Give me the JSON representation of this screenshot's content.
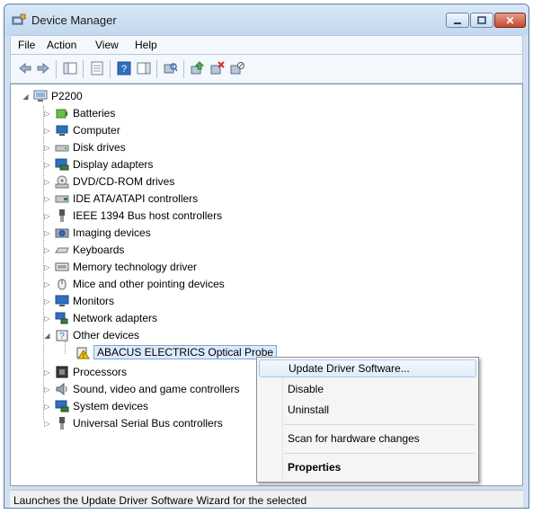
{
  "window": {
    "title": "Device Manager"
  },
  "menu": [
    "File",
    "Action",
    "View",
    "Help"
  ],
  "toolbar_icons": [
    "back-arrow-icon",
    "forward-arrow-icon",
    "show-hide-tree-icon",
    "properties-icon",
    "help-icon",
    "action-pane-icon",
    "scan-hardware-icon",
    "update-driver-icon",
    "uninstall-device-icon",
    "disable-device-icon"
  ],
  "tree": {
    "root": "P2200",
    "categories": [
      {
        "label": "Batteries",
        "icon": "battery-icon",
        "expanded": false
      },
      {
        "label": "Computer",
        "icon": "computer-icon",
        "expanded": false
      },
      {
        "label": "Disk drives",
        "icon": "disk-drive-icon",
        "expanded": false
      },
      {
        "label": "Display adapters",
        "icon": "display-adapter-icon",
        "expanded": false
      },
      {
        "label": "DVD/CD-ROM drives",
        "icon": "dvd-drive-icon",
        "expanded": false
      },
      {
        "label": "IDE ATA/ATAPI controllers",
        "icon": "ide-controller-icon",
        "expanded": false
      },
      {
        "label": "IEEE 1394 Bus host controllers",
        "icon": "firewire-icon",
        "expanded": false
      },
      {
        "label": "Imaging devices",
        "icon": "camera-icon",
        "expanded": false
      },
      {
        "label": "Keyboards",
        "icon": "keyboard-icon",
        "expanded": false
      },
      {
        "label": "Memory technology driver",
        "icon": "memory-icon",
        "expanded": false
      },
      {
        "label": "Mice and other pointing devices",
        "icon": "mouse-icon",
        "expanded": false
      },
      {
        "label": "Monitors",
        "icon": "monitor-icon",
        "expanded": false
      },
      {
        "label": "Network adapters",
        "icon": "network-adapter-icon",
        "expanded": false
      },
      {
        "label": "Other devices",
        "icon": "unknown-device-icon",
        "expanded": true
      },
      {
        "label": "Processors",
        "icon": "processor-icon",
        "expanded": false
      },
      {
        "label": "Sound, video and game controllers",
        "icon": "speaker-icon",
        "expanded": false
      },
      {
        "label": "System devices",
        "icon": "system-device-icon",
        "expanded": false
      },
      {
        "label": "Universal Serial Bus controllers",
        "icon": "usb-icon",
        "expanded": false
      }
    ],
    "selected_child": "ABACUS ELECTRICS Optical Probe"
  },
  "context_menu": {
    "update_driver": "Update Driver Software...",
    "disable": "Disable",
    "uninstall": "Uninstall",
    "scan": "Scan for hardware changes",
    "properties": "Properties"
  },
  "status": "Launches the Update Driver Software Wizard for the selected"
}
